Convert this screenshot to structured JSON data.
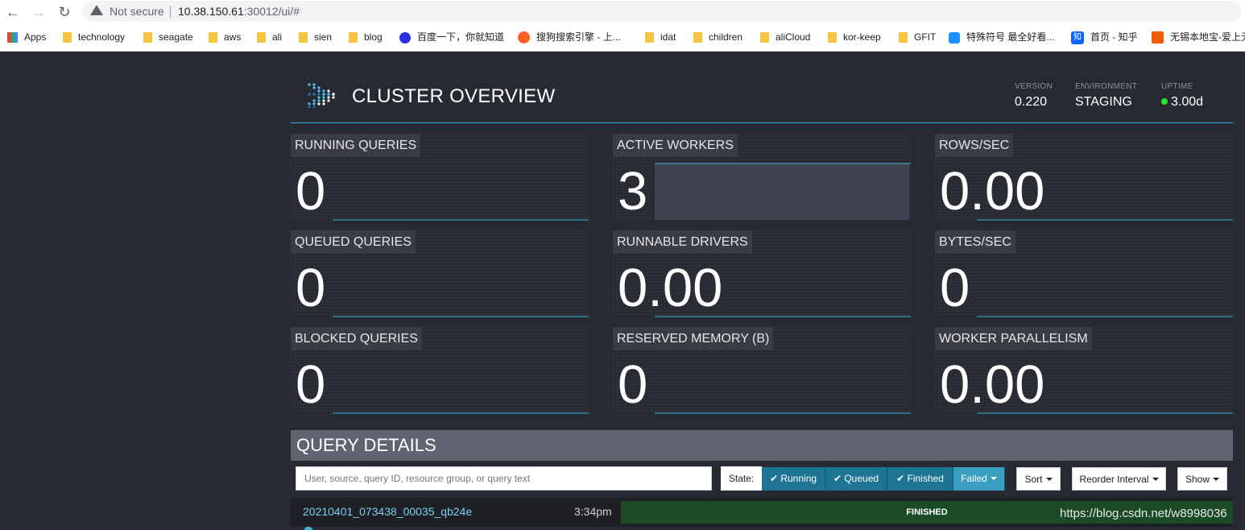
{
  "browser": {
    "security": "Not secure",
    "url_host": "10.38.150.61",
    "url_path": ":30012/ui/#",
    "bookmarks": [
      "Apps",
      "technology",
      "seagate",
      "aws",
      "ali",
      "sien",
      "blog",
      "百度一下，你就知道",
      "搜狗搜索引擎 - 上...",
      "idat",
      "children",
      "aliCloud",
      "kor-keep",
      "GFIT",
      "特殊符号 最全好看...",
      "首页 - 知乎",
      "无锡本地宝-爱上无锡"
    ]
  },
  "header": {
    "title": "CLUSTER OVERVIEW",
    "version_label": "VERSION",
    "version": "0.220",
    "environment_label": "ENVIRONMENT",
    "environment": "STAGING",
    "uptime_label": "UPTIME",
    "uptime": "3.00d",
    "uptime_status_color": "#2ee82e"
  },
  "tiles": [
    {
      "label": "RUNNING QUERIES",
      "value": "0"
    },
    {
      "label": "ACTIVE WORKERS",
      "value": "3"
    },
    {
      "label": "ROWS/SEC",
      "value": "0.00"
    },
    {
      "label": "QUEUED QUERIES",
      "value": "0"
    },
    {
      "label": "RUNNABLE DRIVERS",
      "value": "0.00"
    },
    {
      "label": "BYTES/SEC",
      "value": "0"
    },
    {
      "label": "BLOCKED QUERIES",
      "value": "0"
    },
    {
      "label": "RESERVED MEMORY (B)",
      "value": "0"
    },
    {
      "label": "WORKER PARALLELISM",
      "value": "0.00"
    }
  ],
  "query_details": {
    "title": "QUERY DETAILS",
    "search_placeholder": "User, source, query ID, resource group, or query text",
    "state_label": "State:",
    "states": [
      "Running",
      "Queued",
      "Finished",
      "Failed"
    ],
    "sort_label": "Sort",
    "reorder_label": "Reorder Interval",
    "show_label": "Show",
    "rows": [
      {
        "query_id": "20210401_073438_00035_qb24e",
        "time": "3:34pm",
        "status": "FINISHED"
      }
    ]
  },
  "watermark": "https://blog.csdn.net/w8998036",
  "colors": {
    "accent": "#3bb1d8",
    "state_button": "#1d7493",
    "finished_bar": "#1a4a26"
  }
}
